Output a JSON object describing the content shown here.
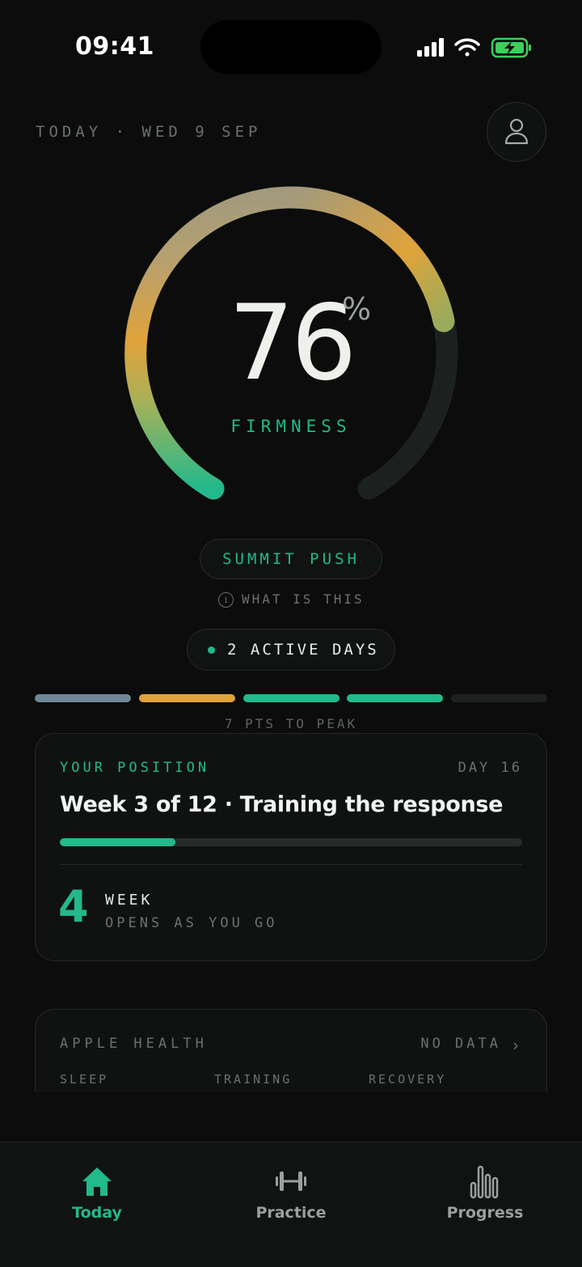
{
  "status_bar": {
    "time": "09:41"
  },
  "header": {
    "date": "TODAY · WED 9 SEP"
  },
  "gauge": {
    "value": "76",
    "unit": "%",
    "label": "FIRMNESS",
    "progress_fraction": 0.76
  },
  "phase": {
    "pill_label": "SUMMIT PUSH",
    "info_label": "WHAT IS THIS",
    "info_icon": "i"
  },
  "activity": {
    "label": "2 ACTIVE DAYS"
  },
  "peak": {
    "segments": [
      "#6f8797",
      "#e0a33b",
      "#22b98c",
      "#22b98c",
      "#1c211f"
    ],
    "caption": "7 PTS TO PEAK"
  },
  "position_card": {
    "heading": "YOUR POSITION",
    "day": "DAY 16",
    "title": "Week 3 of 12 · Training the response",
    "progress_fraction": 0.25,
    "next_number": "4",
    "next_label": "WEEK",
    "next_caption": "OPENS AS YOU GO"
  },
  "health_card": {
    "heading": "APPLE HEALTH",
    "status": "NO DATA",
    "chevron": "›",
    "columns": [
      "SLEEP",
      "TRAINING",
      "RECOVERY"
    ]
  },
  "tabbar": {
    "tabs": [
      {
        "label": "Today",
        "icon": "home-icon",
        "active": true
      },
      {
        "label": "Practice",
        "icon": "dumbbell-icon",
        "active": false
      },
      {
        "label": "Progress",
        "icon": "bar-chart-icon",
        "active": false
      }
    ],
    "active_color": "#22b98c",
    "inactive_color": "#9aa09c"
  },
  "colors": {
    "accent": "#22b98c",
    "warm": "#e0a33b",
    "background": "#0b0c0b"
  }
}
